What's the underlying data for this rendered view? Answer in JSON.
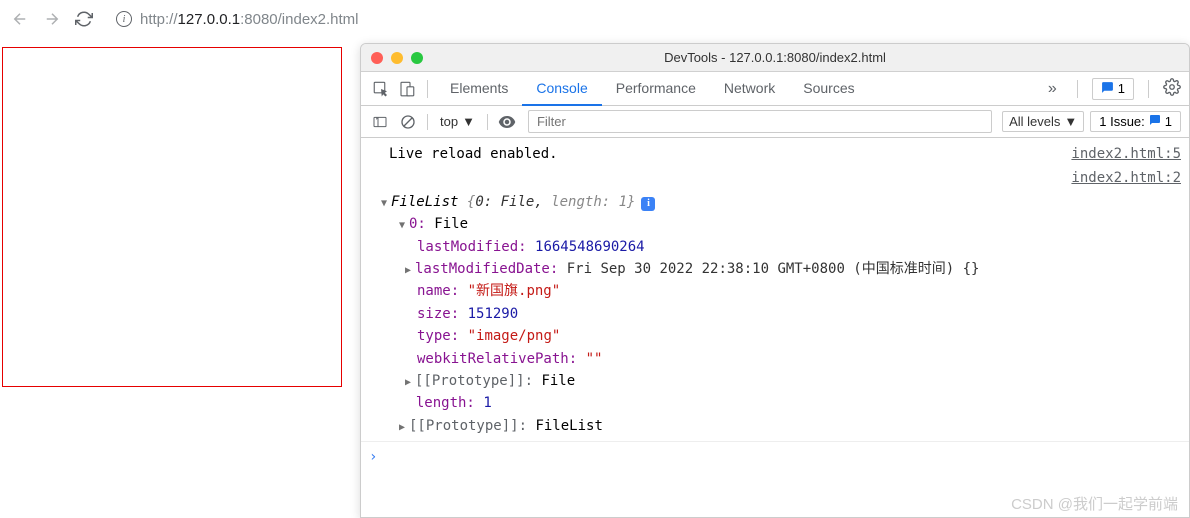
{
  "browser": {
    "url_prefix": "http://",
    "url_host": "127.0.0.1",
    "url_rest": ":8080/index2.html"
  },
  "devtools": {
    "title": "DevTools - 127.0.0.1:8080/index2.html",
    "tabs": [
      "Elements",
      "Console",
      "Performance",
      "Network",
      "Sources"
    ],
    "active_tab": "Console",
    "message_count": "1",
    "filter": {
      "scope": "top",
      "placeholder": "Filter",
      "levels": "All levels",
      "issues_label": "1 Issue:",
      "issues_count": "1"
    },
    "console": {
      "reload_msg": "Live reload enabled.",
      "source_links": [
        "index2.html:5",
        "index2.html:2"
      ],
      "filelist_label": "FileList",
      "filelist_preview": "{0: File, length: 1}",
      "entry_index": "0:",
      "entry_type": "File",
      "props": {
        "lastModified_key": "lastModified:",
        "lastModified_val": "1664548690264",
        "lastModifiedDate_key": "lastModifiedDate:",
        "lastModifiedDate_val": "Fri Sep 30 2022 22:38:10 GMT+0800 (中国标准时间) {}",
        "name_key": "name:",
        "name_val": "\"新国旗.png\"",
        "size_key": "size:",
        "size_val": "151290",
        "type_key": "type:",
        "type_val": "\"image/png\"",
        "webkitRelativePath_key": "webkitRelativePath:",
        "webkitRelativePath_val": "\"\"",
        "proto1_key": "[[Prototype]]:",
        "proto1_val": "File",
        "length_key": "length:",
        "length_val": "1",
        "proto2_key": "[[Prototype]]:",
        "proto2_val": "FileList"
      }
    }
  },
  "watermark": "CSDN @我们一起学前端"
}
